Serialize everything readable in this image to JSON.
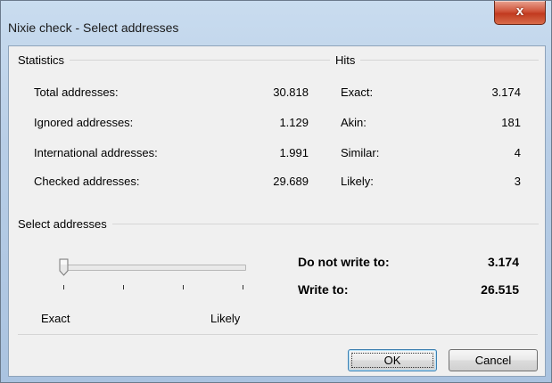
{
  "window": {
    "title": "Nixie check - Select addresses",
    "close_symbol": "x"
  },
  "statistics": {
    "heading": "Statistics",
    "rows": [
      {
        "label": "Total addresses:",
        "value": "30.818"
      },
      {
        "label": "Ignored addresses:",
        "value": "1.129"
      },
      {
        "label": "International addresses:",
        "value": "1.991"
      },
      {
        "label": "Checked addresses:",
        "value": "29.689"
      }
    ]
  },
  "hits": {
    "heading": "Hits",
    "rows": [
      {
        "label": "Exact:",
        "value": "3.174"
      },
      {
        "label": "Akin:",
        "value": "181"
      },
      {
        "label": "Similar:",
        "value": "4"
      },
      {
        "label": "Likely:",
        "value": "3"
      }
    ]
  },
  "select": {
    "heading": "Select addresses",
    "slider": {
      "positions": 4,
      "selected_index": 0,
      "min_label": "Exact",
      "max_label": "Likely"
    },
    "do_not_write_label": "Do not write to:",
    "do_not_write_value": "3.174",
    "write_label": "Write to:",
    "write_value": "26.515"
  },
  "buttons": {
    "ok": "OK",
    "cancel": "Cancel"
  },
  "colors": {
    "title_gradient_top": "#c9dcef",
    "close_button": "#c13a1f",
    "dialog_background": "#f0f0f0",
    "default_button_border": "#3c7fb1"
  }
}
